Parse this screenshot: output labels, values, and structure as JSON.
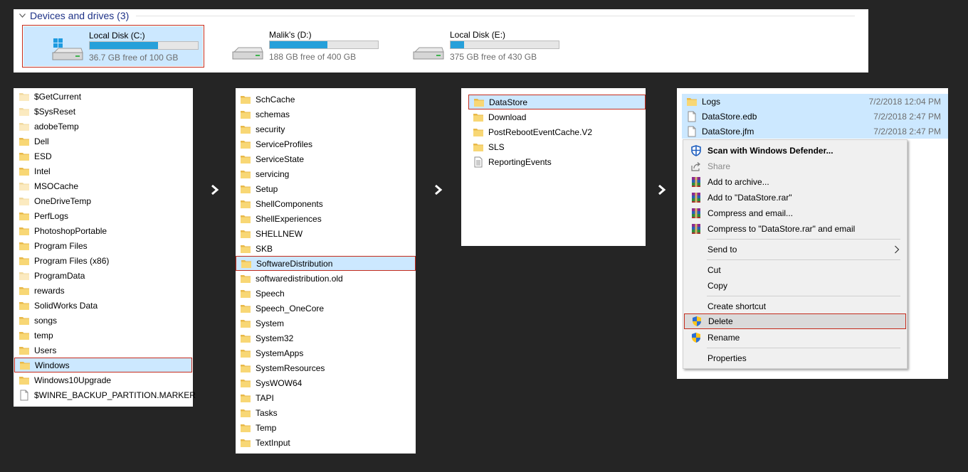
{
  "drives": {
    "header": "Devices and drives (3)",
    "items": [
      {
        "name": "Local Disk (C:)",
        "free": "36.7 GB free of 100 GB",
        "used_fraction": 0.633,
        "selected": true,
        "windows": true
      },
      {
        "name": "Malik's (D:)",
        "free": "188 GB free of 400 GB",
        "used_fraction": 0.53,
        "selected": false,
        "windows": false
      },
      {
        "name": "Local Disk (E:)",
        "free": "375 GB free of 430 GB",
        "used_fraction": 0.128,
        "selected": false,
        "windows": false
      }
    ]
  },
  "panel1": [
    {
      "label": "$GetCurrent",
      "type": "folder-light"
    },
    {
      "label": "$SysReset",
      "type": "folder-light"
    },
    {
      "label": "adobeTemp",
      "type": "folder-light"
    },
    {
      "label": "Dell",
      "type": "folder"
    },
    {
      "label": "ESD",
      "type": "folder"
    },
    {
      "label": "Intel",
      "type": "folder"
    },
    {
      "label": "MSOCache",
      "type": "folder-light"
    },
    {
      "label": "OneDriveTemp",
      "type": "folder-light"
    },
    {
      "label": "PerfLogs",
      "type": "folder"
    },
    {
      "label": "PhotoshopPortable",
      "type": "folder"
    },
    {
      "label": "Program Files",
      "type": "folder"
    },
    {
      "label": "Program Files (x86)",
      "type": "folder"
    },
    {
      "label": "ProgramData",
      "type": "folder-light"
    },
    {
      "label": "rewards",
      "type": "folder"
    },
    {
      "label": "SolidWorks Data",
      "type": "folder"
    },
    {
      "label": "songs",
      "type": "folder"
    },
    {
      "label": "temp",
      "type": "folder"
    },
    {
      "label": "Users",
      "type": "folder"
    },
    {
      "label": "Windows",
      "type": "folder",
      "selected": true
    },
    {
      "label": "Windows10Upgrade",
      "type": "folder"
    },
    {
      "label": "$WINRE_BACKUP_PARTITION.MARKER",
      "type": "file"
    }
  ],
  "panel2": [
    {
      "label": "SchCache",
      "type": "folder"
    },
    {
      "label": "schemas",
      "type": "folder"
    },
    {
      "label": "security",
      "type": "folder"
    },
    {
      "label": "ServiceProfiles",
      "type": "folder"
    },
    {
      "label": "ServiceState",
      "type": "folder"
    },
    {
      "label": "servicing",
      "type": "folder"
    },
    {
      "label": "Setup",
      "type": "folder"
    },
    {
      "label": "ShellComponents",
      "type": "folder"
    },
    {
      "label": "ShellExperiences",
      "type": "folder"
    },
    {
      "label": "SHELLNEW",
      "type": "folder"
    },
    {
      "label": "SKB",
      "type": "folder"
    },
    {
      "label": "SoftwareDistribution",
      "type": "folder",
      "selected": true
    },
    {
      "label": "softwaredistribution.old",
      "type": "folder"
    },
    {
      "label": "Speech",
      "type": "folder"
    },
    {
      "label": "Speech_OneCore",
      "type": "folder"
    },
    {
      "label": "System",
      "type": "folder"
    },
    {
      "label": "System32",
      "type": "folder"
    },
    {
      "label": "SystemApps",
      "type": "folder"
    },
    {
      "label": "SystemResources",
      "type": "folder"
    },
    {
      "label": "SysWOW64",
      "type": "folder"
    },
    {
      "label": "TAPI",
      "type": "folder"
    },
    {
      "label": "Tasks",
      "type": "folder"
    },
    {
      "label": "Temp",
      "type": "folder"
    },
    {
      "label": "TextInput",
      "type": "folder"
    }
  ],
  "panel3": [
    {
      "label": "DataStore",
      "type": "folder",
      "selected": true
    },
    {
      "label": "Download",
      "type": "folder"
    },
    {
      "label": "PostRebootEventCache.V2",
      "type": "folder"
    },
    {
      "label": "SLS",
      "type": "folder"
    },
    {
      "label": "ReportingEvents",
      "type": "textfile"
    }
  ],
  "panel4": [
    {
      "label": "Logs",
      "type": "folder",
      "date": "7/2/2018 12:04 PM",
      "highlight": true
    },
    {
      "label": "DataStore.edb",
      "type": "file",
      "date": "7/2/2018 2:47 PM",
      "highlight": true
    },
    {
      "label": "DataStore.jfm",
      "type": "file",
      "date": "7/2/2018 2:47 PM",
      "highlight": true
    }
  ],
  "context_menu": {
    "scan": "Scan with Windows Defender...",
    "share": "Share",
    "add_archive": "Add to archive...",
    "add_rar": "Add to \"DataStore.rar\"",
    "compress_email": "Compress and email...",
    "compress_rar_email": "Compress to \"DataStore.rar\" and email",
    "send_to": "Send to",
    "cut": "Cut",
    "copy": "Copy",
    "create_shortcut": "Create shortcut",
    "delete": "Delete",
    "rename": "Rename",
    "properties": "Properties"
  },
  "icons": {
    "scan": "defender-shield-icon",
    "share": "share-icon",
    "archive": "winrar-archive-icon",
    "delete": "uac-shield-icon",
    "rename": "uac-shield-icon",
    "send_to": "chevron-right-icon"
  },
  "colors": {
    "background": "#252525",
    "selection": "#cce8ff",
    "highlight_border": "#c42b1c",
    "drive_bar": "#26a0da",
    "folder": "#f8d775",
    "header": "#1e3287"
  }
}
